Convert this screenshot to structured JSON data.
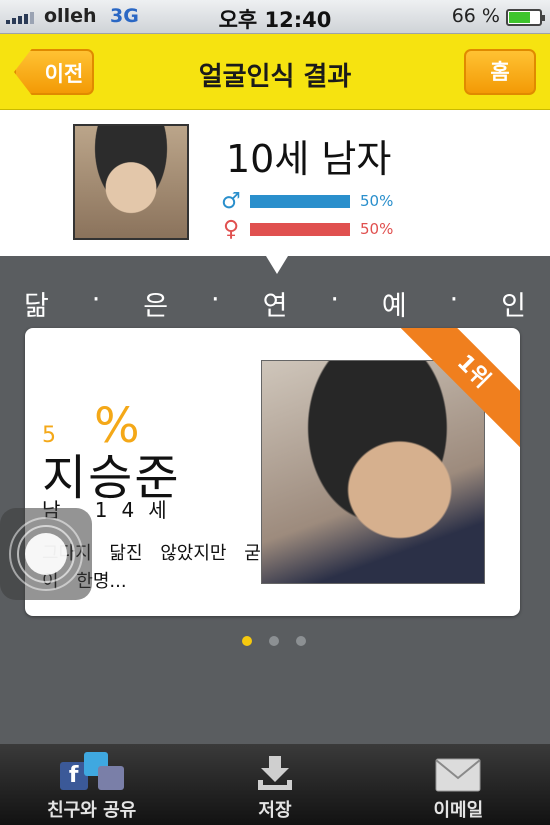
{
  "status_bar": {
    "carrier": "olleh",
    "network": "3G",
    "time": "오후 12:40",
    "battery_label": "66 %",
    "battery_level": 0.66
  },
  "nav": {
    "back_label": "이전",
    "title": "얼굴인식 결과",
    "home_label": "홈"
  },
  "result": {
    "age_gender": "10세 남자",
    "male_symbol": "♂",
    "female_symbol": "♀",
    "male_percent": "50%",
    "female_percent": "50%",
    "male_fraction": 0.5,
    "female_fraction": 0.5
  },
  "match_heading": [
    "닮",
    "·",
    "은",
    "·",
    "연",
    "·",
    "예",
    "·",
    "인"
  ],
  "card": {
    "rank": "1위",
    "score_number": "5",
    "score_unit": "%",
    "name": "지승준",
    "sub": "남 14세",
    "description": "그다지 닮진 않았지만 굳이 한명..."
  },
  "pager": {
    "count": 3,
    "active_index": 0
  },
  "tabs": [
    {
      "label": "친구와 공유",
      "icon": "share-icon"
    },
    {
      "label": "저장",
      "icon": "download-icon"
    },
    {
      "label": "이메일",
      "icon": "mail-icon"
    }
  ],
  "colors": {
    "nav_yellow": "#f6e310",
    "button_orange": "#f39a05",
    "male_blue": "#2a8fcc",
    "female_red": "#e0504f",
    "score_orange": "#f4a818",
    "ribbon_orange": "#f07f1e"
  }
}
